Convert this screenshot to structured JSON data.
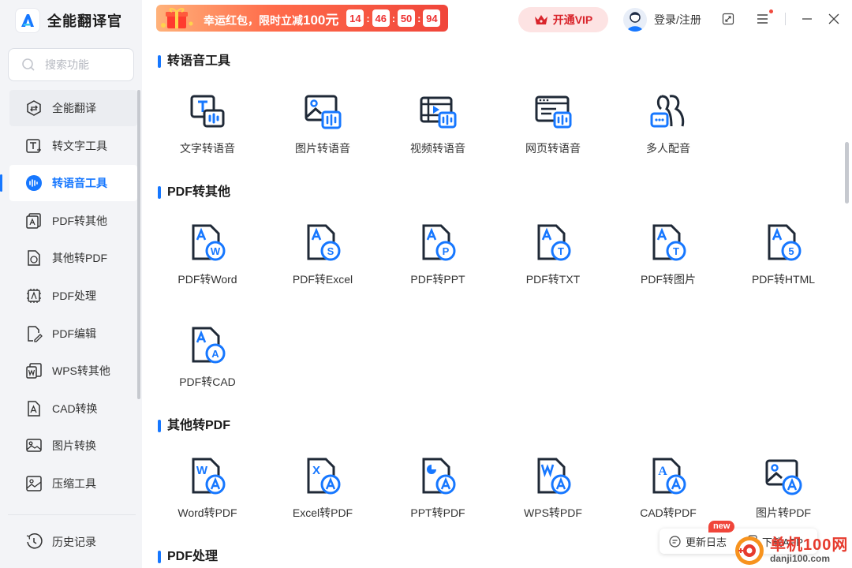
{
  "app": {
    "name": "全能翻译官"
  },
  "search": {
    "placeholder": "搜索功能"
  },
  "sidebar": {
    "items": [
      {
        "label": "全能翻译"
      },
      {
        "label": "转文字工具"
      },
      {
        "label": "转语音工具"
      },
      {
        "label": "PDF转其他"
      },
      {
        "label": "其他转PDF"
      },
      {
        "label": "PDF处理"
      },
      {
        "label": "PDF编辑"
      },
      {
        "label": "WPS转其他"
      },
      {
        "label": "CAD转换"
      },
      {
        "label": "图片转换"
      },
      {
        "label": "压缩工具"
      }
    ],
    "history_label": "历史记录"
  },
  "promo": {
    "text": "幸运红包，限时立减",
    "amount": "100元",
    "countdown": [
      "14",
      "46",
      "50",
      "94"
    ]
  },
  "topbar": {
    "vip_label": "开通VIP",
    "login_label": "登录/注册"
  },
  "sections": [
    {
      "title": "转语音工具",
      "tools": [
        {
          "label": "文字转语音",
          "icon": "text-to-speech-icon"
        },
        {
          "label": "图片转语音",
          "icon": "image-to-speech-icon"
        },
        {
          "label": "视频转语音",
          "icon": "video-to-speech-icon"
        },
        {
          "label": "网页转语音",
          "icon": "webpage-to-speech-icon"
        },
        {
          "label": "多人配音",
          "icon": "multi-voice-icon"
        }
      ]
    },
    {
      "title": "PDF转其他",
      "tools": [
        {
          "label": "PDF转Word",
          "badge": "W"
        },
        {
          "label": "PDF转Excel",
          "badge": "S"
        },
        {
          "label": "PDF转PPT",
          "badge": "P"
        },
        {
          "label": "PDF转TXT",
          "badge": "T"
        },
        {
          "label": "PDF转图片",
          "badge": "T"
        },
        {
          "label": "PDF转HTML",
          "badge": "5"
        },
        {
          "label": "PDF转CAD",
          "badge": "A"
        }
      ]
    },
    {
      "title": "其他转PDF",
      "tools": [
        {
          "label": "Word转PDF",
          "mark": "W"
        },
        {
          "label": "Excel转PDF",
          "mark": "X"
        },
        {
          "label": "PPT转PDF",
          "mark": "pie"
        },
        {
          "label": "WPS转PDF",
          "mark": "wps"
        },
        {
          "label": "CAD转PDF",
          "mark": "A"
        },
        {
          "label": "图片转PDF",
          "mark": "img"
        }
      ]
    },
    {
      "title": "PDF处理"
    }
  ],
  "float": {
    "changelog_label": "更新日志",
    "new_badge": "new",
    "download_label": "下载APP"
  },
  "watermark": {
    "cn": "单机100网",
    "url": "danji100.com"
  },
  "colors": {
    "accent": "#1677ff",
    "icon_dark": "#1f2937",
    "vip_red": "#d9252c"
  }
}
